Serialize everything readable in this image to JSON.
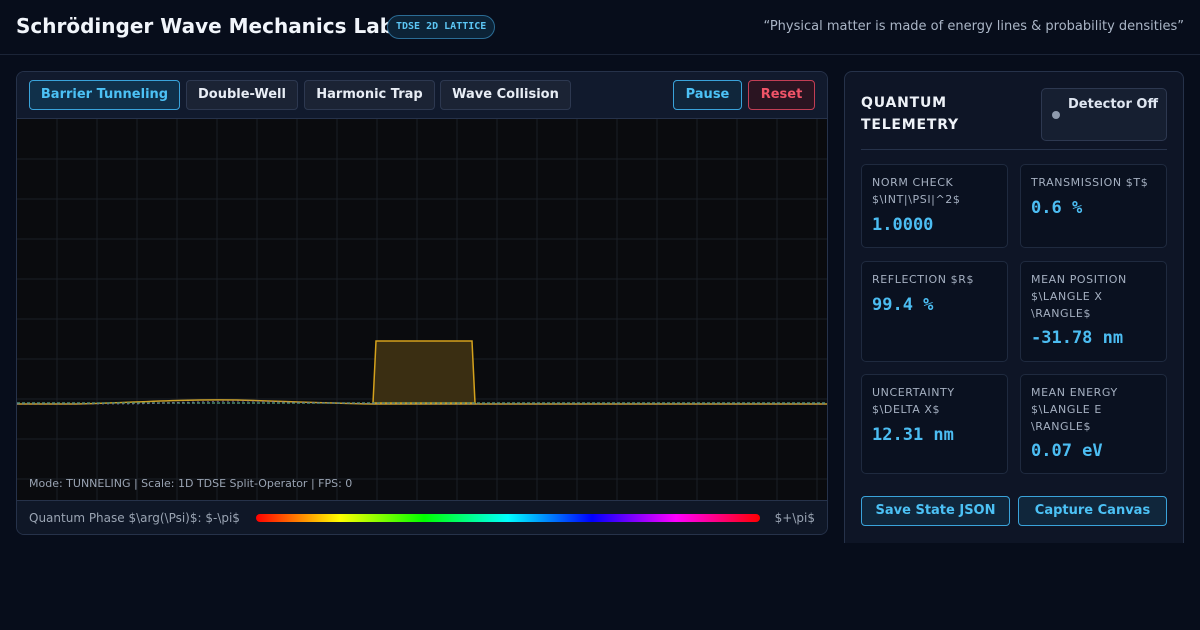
{
  "header": {
    "title": "Schrödinger Wave Mechanics Lab",
    "badge": "TDSE 2D LATTICE",
    "quote": "“Physical matter is made of energy lines & probability densities”"
  },
  "toolbar": {
    "modes": [
      {
        "label": "Barrier Tunneling",
        "active": true
      },
      {
        "label": "Double-Well",
        "active": false
      },
      {
        "label": "Harmonic Trap",
        "active": false
      },
      {
        "label": "Wave Collision",
        "active": false
      }
    ],
    "pause_label": "Pause",
    "reset_label": "Reset"
  },
  "simulation": {
    "status": "Mode: TUNNELING | Scale: 1D TDSE Split-Operator | FPS: 0",
    "phase_label": "Quantum Phase $\\arg(\\Psi)$: $-\\pi$",
    "phase_end": "$+\\pi$",
    "colors": {
      "barrier_stroke": "#d4a11c",
      "barrier_fill": "#3a2e12",
      "wave_real": "#c9a02a",
      "wave_imag": "#4a8a6f",
      "grid": "#1b1f26"
    }
  },
  "telemetry": {
    "title": "QUANTUM TELEMETRY",
    "detector_label": "Detector Off",
    "metrics": [
      {
        "label": "NORM CHECK $\\INT|\\PSI|^2$",
        "value": "1.0000"
      },
      {
        "label": "TRANSMISSION $T$",
        "value": "0.6 %"
      },
      {
        "label": "REFLECTION $R$",
        "value": "99.4 %"
      },
      {
        "label": "MEAN POSITION $\\LANGLE X \\RANGLE$",
        "value": "-31.78 nm"
      },
      {
        "label": "UNCERTAINTY $\\DELTA X$",
        "value": "12.31 nm"
      },
      {
        "label": "MEAN ENERGY $\\LANGLE E \\RANGLE$",
        "value": "0.07 eV"
      }
    ],
    "save_label": "Save State JSON",
    "capture_label": "Capture Canvas"
  }
}
